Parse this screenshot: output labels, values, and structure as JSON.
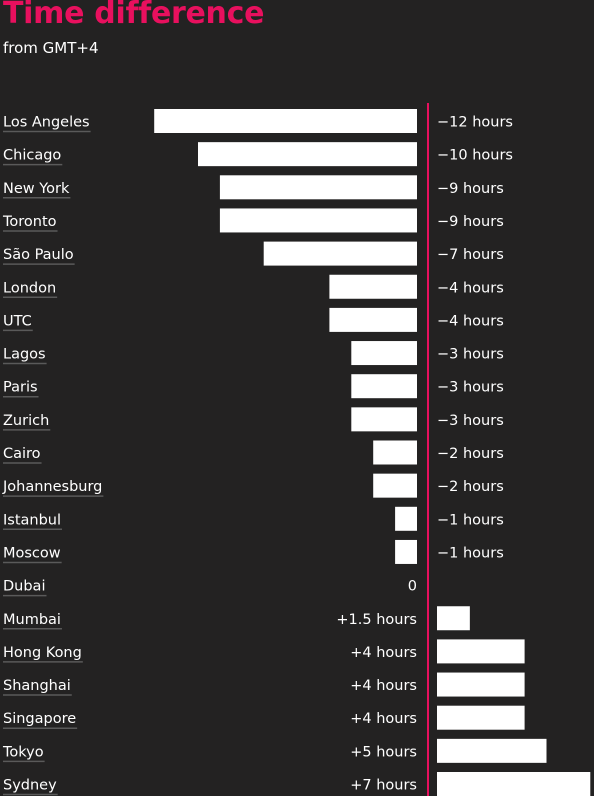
{
  "title": "Time difference",
  "subtitle": "from GMT+4",
  "colors": {
    "background": "#232222",
    "accent": "#e8105e",
    "bar": "#ffffff",
    "text": "#ffffff",
    "underline": "#5a5a5a"
  },
  "chart_data": {
    "type": "bar",
    "orientation": "horizontal",
    "title": "Time difference",
    "subtitle": "from GMT+4",
    "unit": "hours",
    "categories": [
      "Los Angeles",
      "Chicago",
      "New York",
      "Toronto",
      "São Paulo",
      "London",
      "UTC",
      "Lagos",
      "Paris",
      "Zurich",
      "Cairo",
      "Johannesburg",
      "Istanbul",
      "Moscow",
      "Dubai",
      "Mumbai",
      "Hong Kong",
      "Shanghai",
      "Singapore",
      "Tokyo",
      "Sydney"
    ],
    "values": [
      -12,
      -10,
      -9,
      -9,
      -7,
      -4,
      -4,
      -3,
      -3,
      -3,
      -2,
      -2,
      -1,
      -1,
      0,
      1.5,
      4,
      4,
      4,
      5,
      7
    ],
    "value_labels": [
      "−12 hours",
      "−10 hours",
      "−9 hours",
      "−9 hours",
      "−7 hours",
      "−4 hours",
      "−4 hours",
      "−3 hours",
      "−3 hours",
      "−3 hours",
      "−2 hours",
      "−2 hours",
      "−1 hours",
      "−1 hours",
      "0",
      "+1.5 hours",
      "+4 hours",
      "+4 hours",
      "+4 hours",
      "+5 hours",
      "+7 hours"
    ],
    "xlim": [
      -12,
      7
    ],
    "baseline": 0,
    "legend": "none",
    "grid": false
  }
}
